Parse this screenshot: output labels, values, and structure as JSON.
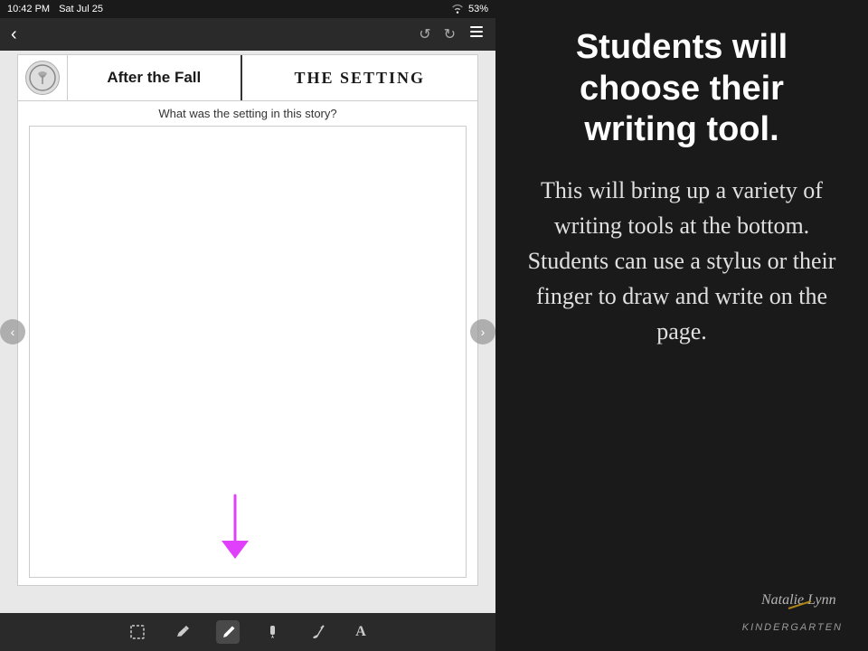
{
  "status_bar": {
    "time": "10:42 PM",
    "date": "Sat Jul 25",
    "battery": "53%",
    "wifi_icon": "wifi"
  },
  "toolbar": {
    "back_label": "‹",
    "undo_label": "↺",
    "redo_label": "↻",
    "more_label": "•••"
  },
  "page": {
    "book_title": "After the Fall",
    "section_title": "THE SETTING",
    "question": "What was the setting in this story?"
  },
  "tools": [
    {
      "id": "select",
      "icon": "▣",
      "label": "select-tool"
    },
    {
      "id": "pencil",
      "icon": "✏",
      "label": "pencil-tool"
    },
    {
      "id": "pen",
      "icon": "✒",
      "label": "pen-tool",
      "active": true
    },
    {
      "id": "marker",
      "icon": "🖊",
      "label": "marker-tool"
    },
    {
      "id": "brush",
      "icon": "🖌",
      "label": "brush-tool"
    },
    {
      "id": "text",
      "icon": "A",
      "label": "text-tool"
    }
  ],
  "right": {
    "heading": "Students will choose their writing tool.",
    "body": "This will bring up a variety of writing tools at the bottom. Students can use a stylus or their finger to draw and write on the page.",
    "branding_name": "Natalie Lynn",
    "branding_sub": "KINDERGARTEN"
  }
}
